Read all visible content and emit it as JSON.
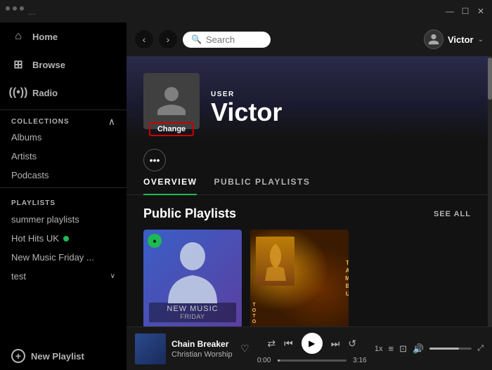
{
  "titleBar": {
    "dotsLabel": "...",
    "minLabel": "—",
    "restoreLabel": "☐",
    "closeLabel": "✕"
  },
  "topNav": {
    "backArrow": "‹",
    "forwardArrow": "›",
    "searchPlaceholder": "Search",
    "userName": "Victor",
    "chevron": "⌄"
  },
  "sidebar": {
    "navItems": [
      {
        "label": "Home",
        "icon": "⌂"
      },
      {
        "label": "Browse",
        "icon": "⊞"
      },
      {
        "label": "Radio",
        "icon": "⊙"
      }
    ],
    "collectionsLabel": "COLLECTIONS",
    "collectionItems": [
      {
        "label": "Albums"
      },
      {
        "label": "Artists"
      },
      {
        "label": "Podcasts"
      }
    ],
    "playlistsLabel": "PLAYLISTS",
    "playlists": [
      {
        "label": "summer playlists",
        "hasUpArrow": true
      },
      {
        "label": "Hot Hits UK",
        "hasDot": true
      },
      {
        "label": "New Music Friday ...",
        "hasDot": false
      },
      {
        "label": "test",
        "hasChevron": true
      }
    ],
    "newPlaylistLabel": "New Playlist"
  },
  "profile": {
    "userLabel": "USER",
    "userName": "Victor",
    "changeLabel": "Change"
  },
  "tabs": [
    {
      "label": "OVERVIEW",
      "active": true
    },
    {
      "label": "PUBLIC PLAYLISTS",
      "active": false
    }
  ],
  "publicPlaylists": {
    "sectionTitle": "Public Playlists",
    "seeAllLabel": "SEE ALL",
    "cards": [
      {
        "title": "New Music Friday",
        "type": "new-music"
      },
      {
        "title": "TAMBU - TOTO",
        "type": "tanbu"
      }
    ]
  },
  "player": {
    "trackName": "Chain Breaker",
    "trackArtist": "Christian Worship",
    "currentTime": "0:00",
    "totalTime": "3:16",
    "speedLabel": "1x"
  }
}
